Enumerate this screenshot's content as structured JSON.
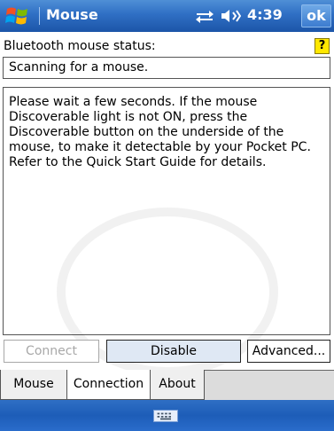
{
  "titlebar": {
    "title": "Mouse",
    "clock": "4:39",
    "ok_label": "ok",
    "icons": [
      "windows-start-icon",
      "connectivity-icon",
      "volume-icon"
    ]
  },
  "status": {
    "label": "Bluetooth mouse status:",
    "help_label": "?",
    "value": "Scanning for a mouse."
  },
  "info": {
    "text": "Please wait a few seconds. If the mouse Discoverable light is not ON, press the Discoverable button on the underside of the mouse, to make it detectable by your Pocket PC. Refer to the Quick Start Guide for details."
  },
  "buttons": {
    "connect": "Connect",
    "disable": "Disable",
    "advanced": "Advanced..."
  },
  "tabs": [
    {
      "label": "Mouse",
      "active": false
    },
    {
      "label": "Connection",
      "active": true
    },
    {
      "label": "About",
      "active": false
    }
  ],
  "bottombar": {
    "icon": "keyboard-icon"
  },
  "colors": {
    "title_bar": "#2f6fc4",
    "help_badge": "#ffe800",
    "disabled_text": "#a8a8a8"
  }
}
